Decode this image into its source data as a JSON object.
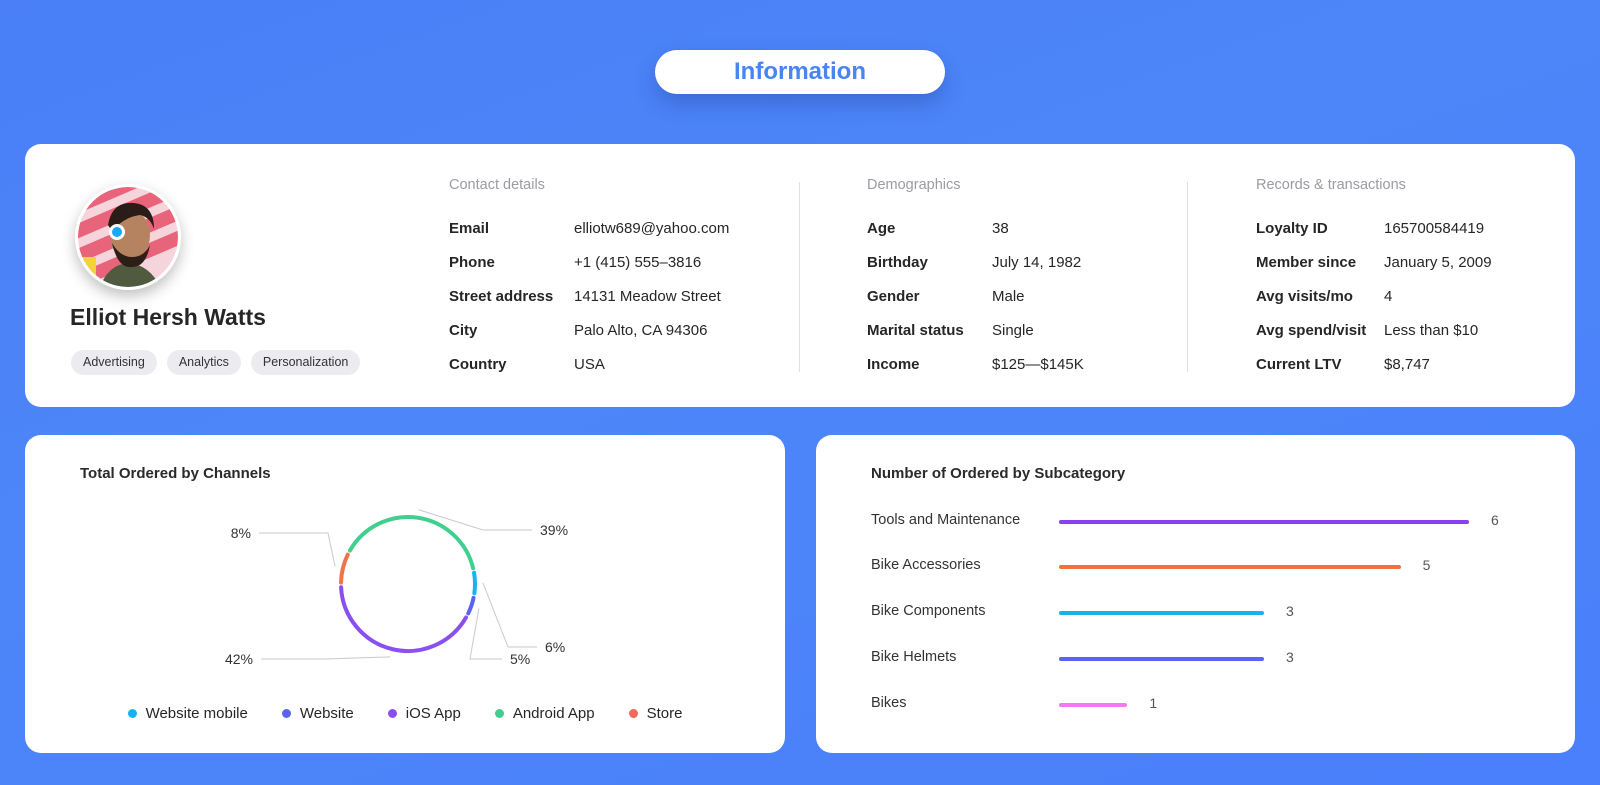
{
  "header": {
    "title": "Information"
  },
  "profile": {
    "name": "Elliot Hersh Watts",
    "tags": [
      "Advertising",
      "Analytics",
      "Personalization"
    ],
    "status_color": "#1aa7ff"
  },
  "contact": {
    "title": "Contact details",
    "rows": [
      {
        "label": "Email",
        "value": "elliotw689@yahoo.com"
      },
      {
        "label": "Phone",
        "value": "+1 (415) 555–3816"
      },
      {
        "label": "Street address",
        "value": "14131 Meadow Street"
      },
      {
        "label": "City",
        "value": "Palo Alto, CA 94306"
      },
      {
        "label": "Country",
        "value": "USA"
      }
    ]
  },
  "demographics": {
    "title": "Demographics",
    "rows": [
      {
        "label": "Age",
        "value": "38"
      },
      {
        "label": "Birthday",
        "value": "July 14, 1982"
      },
      {
        "label": "Gender",
        "value": "Male"
      },
      {
        "label": "Marital status",
        "value": "Single"
      },
      {
        "label": "Income",
        "value": "$125—$145K"
      }
    ]
  },
  "records": {
    "title": "Records & transactions",
    "rows": [
      {
        "label": "Loyalty ID",
        "value": "165700584419"
      },
      {
        "label": "Member since",
        "value": "January 5, 2009"
      },
      {
        "label": "Avg visits/mo",
        "value": "4"
      },
      {
        "label": "Avg spend/visit",
        "value": "Less than $10"
      },
      {
        "label": "Current LTV",
        "value": "$8,747"
      }
    ]
  },
  "channels": {
    "title": "Total Ordered by Channels",
    "legend": [
      {
        "name": "Website mobile",
        "color": "#17b3ef"
      },
      {
        "name": "Website",
        "color": "#5a64f0"
      },
      {
        "name": "iOS App",
        "color": "#8a4ff0"
      },
      {
        "name": "Android App",
        "color": "#3fcf8e"
      },
      {
        "name": "Store",
        "color": "#f06a5a"
      }
    ]
  },
  "subcategory": {
    "title": "Number of Ordered by Subcategory"
  },
  "chart_data": [
    {
      "type": "pie",
      "title": "Total Ordered by Channels",
      "categories": [
        "Android App",
        "Website mobile",
        "Website",
        "iOS App",
        "Store"
      ],
      "values": [
        39,
        6,
        5,
        42,
        8
      ],
      "labels": [
        "39%",
        "6%",
        "5%",
        "42%",
        "8%"
      ],
      "colors": [
        "#3fcf8e",
        "#17b3ef",
        "#5a64f0",
        "#8a4ff0",
        "#f0734a"
      ]
    },
    {
      "type": "bar",
      "title": "Number of Ordered by Subcategory",
      "categories": [
        "Tools and Maintenance",
        "Bike Accessories",
        "Bike Components",
        "Bike Helmets",
        "Bikes"
      ],
      "values": [
        6,
        5,
        3,
        3,
        1
      ],
      "colors": [
        "#8a3ff0",
        "#f0733c",
        "#17b3ef",
        "#5a64f0",
        "#f07af0"
      ],
      "xlim": [
        0,
        6
      ]
    }
  ]
}
